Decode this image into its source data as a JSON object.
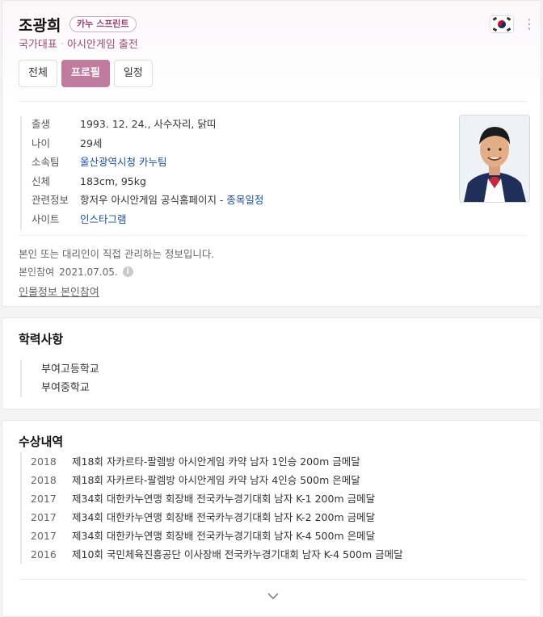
{
  "profile": {
    "name": "조광희",
    "badge": "카누 스프린트",
    "subtitle": [
      "국가대표",
      "아시안게임 출전"
    ],
    "flag_icon": "korea-flag-icon",
    "more_icon": "more-vertical-icon",
    "tabs": [
      {
        "label": "전체",
        "active": false
      },
      {
        "label": "프로필",
        "active": true
      },
      {
        "label": "일정",
        "active": false
      }
    ],
    "info": [
      {
        "key": "출생",
        "value": "1993. 12. 24., 사수자리, 닭띠"
      },
      {
        "key": "나이",
        "value": "29세"
      },
      {
        "key": "소속팀",
        "value": "울산광역시청 카누팀"
      },
      {
        "key": "신체",
        "value": "183cm, 95kg"
      },
      {
        "key": "관련정보",
        "value": "항저우 아시안게임 공식홈페이지",
        "value_link": "종목일정"
      },
      {
        "key": "사이트",
        "value": "인스타그램"
      }
    ],
    "note": "본인 또는 대리인이 직접 관리하는 정보입니다.",
    "joined_label": "본인참여",
    "joined_date": "2021.07.05.",
    "joined_info_icon": "info-icon",
    "self_link": "인물정보 본인참여"
  },
  "education": {
    "title": "학력사항",
    "items": [
      "부여고등학교",
      "부여중학교"
    ]
  },
  "awards": {
    "title": "수상내역",
    "items": [
      {
        "year": "2018",
        "text": "제18회 자카르타-팔렘방 아시안게임 카약 남자 1인승 200m 금메달"
      },
      {
        "year": "2018",
        "text": "제18회 자카르타-팔렘방 아시안게임 카약 남자 4인승 500m 은메달"
      },
      {
        "year": "2017",
        "text": "제34회 대한카누연맹 회장배 전국카누경기대회 남자 K-1 200m 금메달"
      },
      {
        "year": "2017",
        "text": "제34회 대한카누연맹 회장배 전국카누경기대회 남자 K-2 200m 금메달"
      },
      {
        "year": "2017",
        "text": "제34회 대한카누연맹 회장배 전국카누경기대회 남자 K-4 500m 은메달"
      },
      {
        "year": "2016",
        "text": "제10회 국민체육진흥공단 이사장배 전국카누경기대회 남자 K-4 500m 금메달"
      }
    ],
    "expand_icon": "chevron-down-icon"
  },
  "colors": {
    "accent": "#c07c9e",
    "badge_text": "#9b3d6f",
    "link": "#1c4fa0"
  }
}
